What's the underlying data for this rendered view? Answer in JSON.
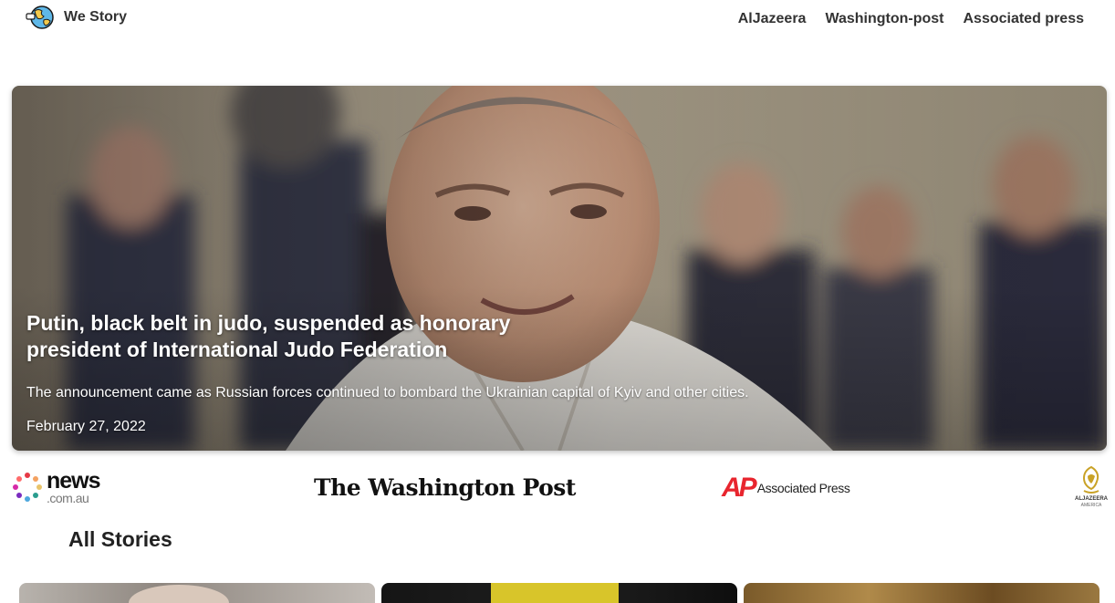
{
  "header": {
    "brand": "We Story",
    "brand_icon": "globe-icon",
    "nav": [
      "AlJazeera",
      "Washington-post",
      "Associated press"
    ]
  },
  "hero": {
    "title": "Putin, black belt in judo, suspended as honorary president of International Judo Federation",
    "description": "The announcement came as Russian forces continued to bombard the Ukrainian capital of Kyiv and other cities.",
    "date": "February 27, 2022"
  },
  "sources": {
    "news_word": "news",
    "news_sub": ".com.au",
    "wapo": "The Washington Post",
    "ap_mark": "AP",
    "ap_name": "Associated Press",
    "aj_name": "ALJAZEERA",
    "aj_sub": "AMERICA"
  },
  "stories": {
    "title": "All Stories"
  },
  "colors": {
    "ap_red": "#e8252e",
    "text": "#222222"
  }
}
